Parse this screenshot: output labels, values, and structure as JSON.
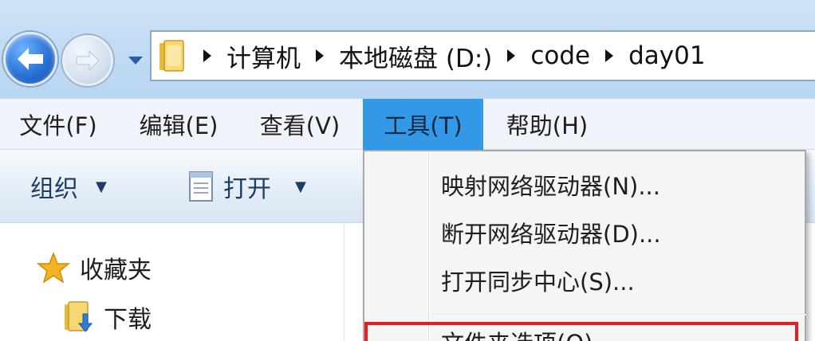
{
  "address_bar": {
    "breadcrumbs": [
      "计算机",
      "本地磁盘 (D:)",
      "code",
      "day01"
    ],
    "icons": {
      "back": "back-arrow-icon",
      "forward": "forward-arrow-icon",
      "history": "chevron-down-icon",
      "folder": "folder-icon",
      "separator": "chevron-right-icon"
    }
  },
  "menubar": {
    "items": [
      {
        "label": "文件(F)"
      },
      {
        "label": "编辑(E)"
      },
      {
        "label": "查看(V)"
      },
      {
        "label": "工具(T)",
        "active": true
      },
      {
        "label": "帮助(H)"
      }
    ]
  },
  "toolbar": {
    "organize_label": "组织",
    "open_label": "打开"
  },
  "navpane": {
    "favorites_label": "收藏夹",
    "downloads_label": "下载"
  },
  "tools_menu": {
    "items": [
      {
        "label": "映射网络驱动器(N)..."
      },
      {
        "label": "断开网络驱动器(D)..."
      },
      {
        "label": "打开同步中心(S)..."
      },
      {
        "label": "文件夹选项(O)..."
      }
    ]
  },
  "colors": {
    "menu_active": "#3399e6",
    "highlight_box": "#e02020",
    "address_border": "#8ea6c4"
  }
}
